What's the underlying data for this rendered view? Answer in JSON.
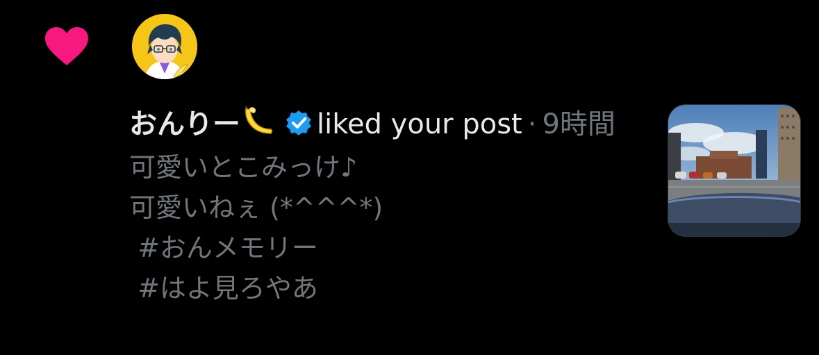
{
  "notification": {
    "type_icon": "heart-icon",
    "accent_color": "#f91880",
    "user": {
      "avatar_icon": "avatar-anime-glasses",
      "display_name": "おんりー",
      "emoji_icon": "banana-icon",
      "verified_icon": "verified-badge-icon",
      "verified_color": "#1d9bf0"
    },
    "action_text": "liked your post",
    "separator": "·",
    "timestamp": "9時間",
    "post_lines": [
      "可愛いとこみっけ♪",
      "可愛いねぇ (*^^^*)",
      " #おんメモリー",
      " #はよ見ろやあ"
    ],
    "thumbnail_icon": "car-parking-photo"
  }
}
